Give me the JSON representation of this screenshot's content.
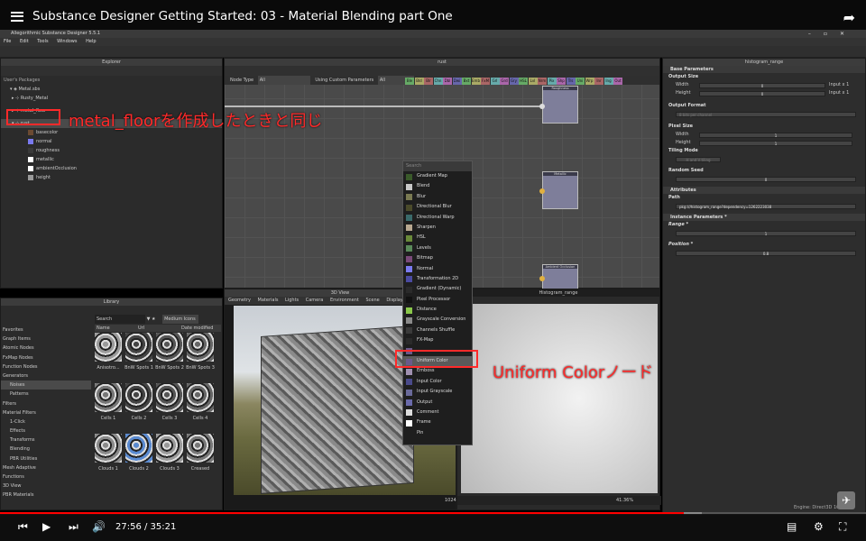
{
  "video": {
    "title": "Substance Designer Getting Started: 03 - Material Blending part One",
    "time": "27:56 / 35:21",
    "progress_pct": 79,
    "buffered_pct": 81
  },
  "app": {
    "title": "Allegorithmic Substance Designer 5.5.1",
    "menu": [
      "File",
      "Edit",
      "Tools",
      "Windows",
      "Help"
    ]
  },
  "explorer": {
    "title": "Explorer",
    "section": "User's Packages",
    "items": [
      "Metal.sbs",
      "Rusty_Metal",
      "metal_floor",
      "rust"
    ],
    "outputs": [
      {
        "label": "basecolor",
        "color": "#6b4a32"
      },
      {
        "label": "normal",
        "color": "#7a7af0"
      },
      {
        "label": "roughness",
        "color": "#3a3a3a"
      },
      {
        "label": "metallic",
        "color": "#ffffff"
      },
      {
        "label": "ambientOcclusion",
        "color": "#ffffff"
      },
      {
        "label": "height",
        "color": "#9a9a9a"
      }
    ]
  },
  "graph": {
    "title": "rust",
    "filter_label": "Node Type",
    "filter_value": "All",
    "custom_label": "Using Custom Parameters",
    "custom_value": "All",
    "chips": [
      "Ble",
      "Bld",
      "Blr",
      "Chn",
      "Dbl",
      "Dwi",
      "Bxt",
      "Emb",
      "FxM",
      "Grl",
      "Grd",
      "Gry",
      "HSL",
      "Lvl",
      "Nrm",
      "Pix",
      "Shp",
      "Trs",
      "Uni",
      "Wrp",
      "Inr",
      "Ing",
      "Out"
    ],
    "nodes": [
      "Roughness",
      "Metallic",
      "Ambient Occlusion"
    ]
  },
  "menu": {
    "search": "Search",
    "items": [
      {
        "label": "Gradient Map",
        "color": "#3a5a2a"
      },
      {
        "label": "Blend",
        "color": "#c8c8c8"
      },
      {
        "label": "Blur",
        "color": "#7a7a52"
      },
      {
        "label": "Directional Blur",
        "color": "#4a4a2a"
      },
      {
        "label": "Directional Warp",
        "color": "#3a6a6a"
      },
      {
        "label": "Sharpen",
        "color": "#b8a890"
      },
      {
        "label": "HSL",
        "color": "#6a8a3a"
      },
      {
        "label": "Levels",
        "color": "#5a8a5a"
      },
      {
        "label": "Bitmap",
        "color": "#7a4a7a"
      },
      {
        "label": "Normal",
        "color": "#7a7af0"
      },
      {
        "label": "Transformation 2D",
        "color": "#4a4aa0"
      },
      {
        "label": "Gradient (Dynamic)",
        "color": "#2a2a2a"
      },
      {
        "label": "Pixel Processor",
        "color": "#111111"
      },
      {
        "label": "Distance",
        "color": "#8ac84a"
      },
      {
        "label": "Grayscale Conversion",
        "color": "#8a8a8a"
      },
      {
        "label": "Channels Shuffle",
        "color": "#3a3a3a"
      },
      {
        "label": "FX-Map",
        "color": "#2a2a2a"
      },
      {
        "label": "",
        "color": "#6a5a8a"
      },
      {
        "label": "Uniform Color",
        "color": "#6a5a8a"
      },
      {
        "label": "Emboss",
        "color": "#a090b0"
      },
      {
        "label": "Input Color",
        "color": "#4a4a8a"
      },
      {
        "label": "Input Grayscale",
        "color": "#6a6a9a"
      },
      {
        "label": "Output",
        "color": "#6a6aaa"
      },
      {
        "label": "Comment",
        "color": "#dddddd"
      },
      {
        "label": "Frame",
        "color": "#ffffff"
      },
      {
        "label": "Pin",
        "color": "#1e1e1e"
      }
    ]
  },
  "library": {
    "title": "Library",
    "search": "Search",
    "sort": "Medium Icons",
    "col_name": "Name",
    "col_url": "Url",
    "col_date": "Date modified",
    "categories": [
      "Favorites",
      "Graph Items",
      "Atomic Nodes",
      "FxMap Nodes",
      "Function Nodes",
      "Generators",
      "Noises",
      "Patterns",
      "Filters",
      "Material Filters",
      "1-Click",
      "Effects",
      "Transforms",
      "Blending",
      "PBR Utilities",
      "Mesh Adaptive",
      "Functions",
      "3D View",
      "PBR Materials"
    ],
    "thumbs": [
      "Anisotro...",
      "BnW Spots 1",
      "BnW Spots 2",
      "BnW Spots 3",
      "Cells 1",
      "Cells 2",
      "Cells 3",
      "Cells 4",
      "Clouds 1",
      "Clouds 2",
      "Clouds 3",
      "Creased"
    ]
  },
  "view3d": {
    "title": "3D View",
    "menu": [
      "Geometry",
      "Materials",
      "Lights",
      "Camera",
      "Environment",
      "Scene",
      "Display"
    ]
  },
  "view2d": {
    "title": "Histogram_range",
    "zoom": "41.36%",
    "size": "1024"
  },
  "props": {
    "title": "histogram_range",
    "base": "Base Parameters",
    "output_size": "Output Size",
    "width": "Width",
    "height": "Height",
    "width_value": "0",
    "height_value": "0",
    "rel_input": "Input x 1",
    "output_format": "Output Format",
    "format_value": "8 bits per channel",
    "pixel_size": "Pixel Size",
    "ps_value": "1",
    "tiling": "Tiling Mode",
    "tiling_value": "H and V tiling",
    "seed": "Random Seed",
    "seed_value": "0",
    "attributes": "Attributes",
    "path": "Path",
    "path_value": "pkg:///histogram_range?dependency=1262223038",
    "instance": "Instance Parameters *",
    "range": "Range *",
    "range_value": "1",
    "position": "Position *",
    "position_value": "0.8"
  },
  "status": "Engine: Direct3D 10",
  "annotations": {
    "a1": "metal_floorを作成したときと同じ",
    "a2": "Uniform Colorノード"
  }
}
